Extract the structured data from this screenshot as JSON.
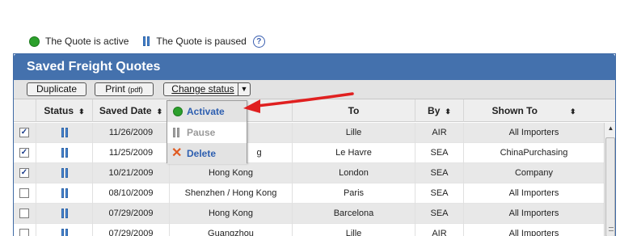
{
  "legend": {
    "active_label": "The Quote is active",
    "paused_label": "The Quote is paused",
    "help": "?"
  },
  "panel": {
    "title": "Saved Freight Quotes"
  },
  "toolbar": {
    "duplicate": "Duplicate",
    "print": "Print",
    "print_suffix": "(pdf)",
    "change_status": "Change status",
    "caret": "▼"
  },
  "columns": {
    "status": "Status",
    "saved_date": "Saved Date",
    "from": "",
    "to": "To",
    "by": "By",
    "shown_to": "Shown To",
    "sort_icon": "⬍"
  },
  "rows": [
    {
      "checked": true,
      "check": "✓",
      "date": "11/26/2009",
      "from": "",
      "to": "Lille",
      "by": "AIR",
      "shown": "All Importers"
    },
    {
      "checked": true,
      "check": "✓",
      "date": "11/25/2009",
      "from": "g",
      "to": "Le Havre",
      "by": "SEA",
      "shown": "ChinaPurchasing"
    },
    {
      "checked": true,
      "check": "✓",
      "date": "10/21/2009",
      "from": "Hong Kong",
      "to": "London",
      "by": "SEA",
      "shown": "Company"
    },
    {
      "checked": false,
      "check": "",
      "date": "08/10/2009",
      "from": "Shenzhen / Hong Kong",
      "to": "Paris",
      "by": "SEA",
      "shown": "All Importers"
    },
    {
      "checked": false,
      "check": "",
      "date": "07/29/2009",
      "from": "Hong Kong",
      "to": "Barcelona",
      "by": "SEA",
      "shown": "All Importers"
    },
    {
      "checked": false,
      "check": "",
      "date": "07/29/2009",
      "from": "Guangzhou",
      "to": "Lille",
      "by": "AIR",
      "shown": "All Importers"
    }
  ],
  "dropdown": {
    "activate": "Activate",
    "pause": "Pause",
    "delete": "Delete",
    "delete_icon": "✕"
  },
  "colors": {
    "header_blue": "#4471ad",
    "active_green": "#2ca02c",
    "arrow_red": "#e02020"
  }
}
